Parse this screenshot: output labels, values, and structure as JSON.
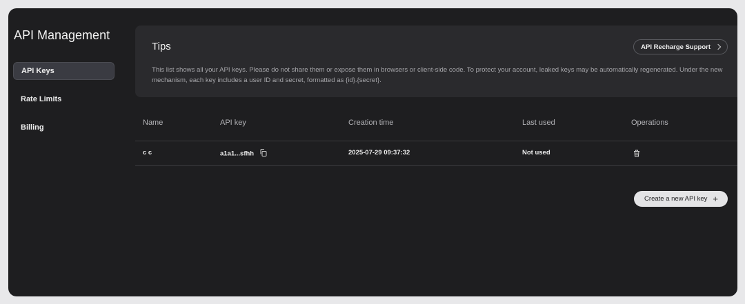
{
  "app": {
    "title": "API Management"
  },
  "sidebar": {
    "items": [
      {
        "label": "API Keys",
        "active": true
      },
      {
        "label": "Rate Limits",
        "active": false
      },
      {
        "label": "Billing",
        "active": false
      }
    ]
  },
  "tips": {
    "title": "Tips",
    "recharge_label": "API Recharge Support",
    "text": "This list shows all your API keys. Please do not share them or expose them in browsers or client-side code. To protect your account, leaked keys may be automatically regenerated. Under the new mechanism, each key includes a user ID and secret, formatted as {id}.{secret}."
  },
  "table": {
    "headers": {
      "name": "Name",
      "api_key": "API key",
      "creation_time": "Creation time",
      "last_used": "Last used",
      "operations": "Operations"
    },
    "rows": [
      {
        "name": "c c",
        "api_key": "a1a1...sfhh",
        "creation_time": "2025-07-29 09:37:32",
        "last_used": "Not used"
      }
    ]
  },
  "actions": {
    "create_label": "Create a new API key",
    "create_icon": "plus-icon"
  },
  "icons": {
    "copy": "copy-icon",
    "delete": "trash-icon",
    "chevron": "chevron-right-icon"
  },
  "colors": {
    "background": "#1e1e20",
    "panel": "#2a2a2d",
    "active_nav": "#3a3b42",
    "primary_button": "#e4e4e6"
  }
}
